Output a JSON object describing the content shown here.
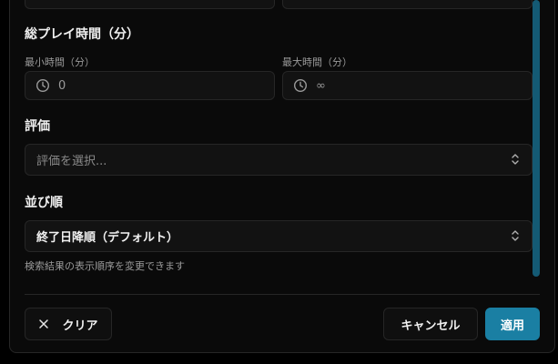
{
  "top_inputs": {
    "from_value": "-",
    "to_value": "-"
  },
  "playtime": {
    "section_title": "総プレイ時間（分）",
    "min_label": "最小時間（分）",
    "min_value": "0",
    "max_label": "最大時間（分）",
    "max_value": "∞"
  },
  "rating": {
    "section_title": "評価",
    "placeholder": "評価を選択..."
  },
  "sort": {
    "section_title": "並び順",
    "selected": "終了日降順（デフォルト）",
    "hint": "検索結果の表示順序を変更できます"
  },
  "footer": {
    "clear_label": "クリア",
    "cancel_label": "キャンセル",
    "apply_label": "適用"
  },
  "colors": {
    "accent": "#1a7fa3",
    "scrollbar": "#145a74",
    "background": "#0a0a0a"
  },
  "icons": [
    "clock-icon",
    "chevron-updown-icon",
    "close-icon"
  ]
}
